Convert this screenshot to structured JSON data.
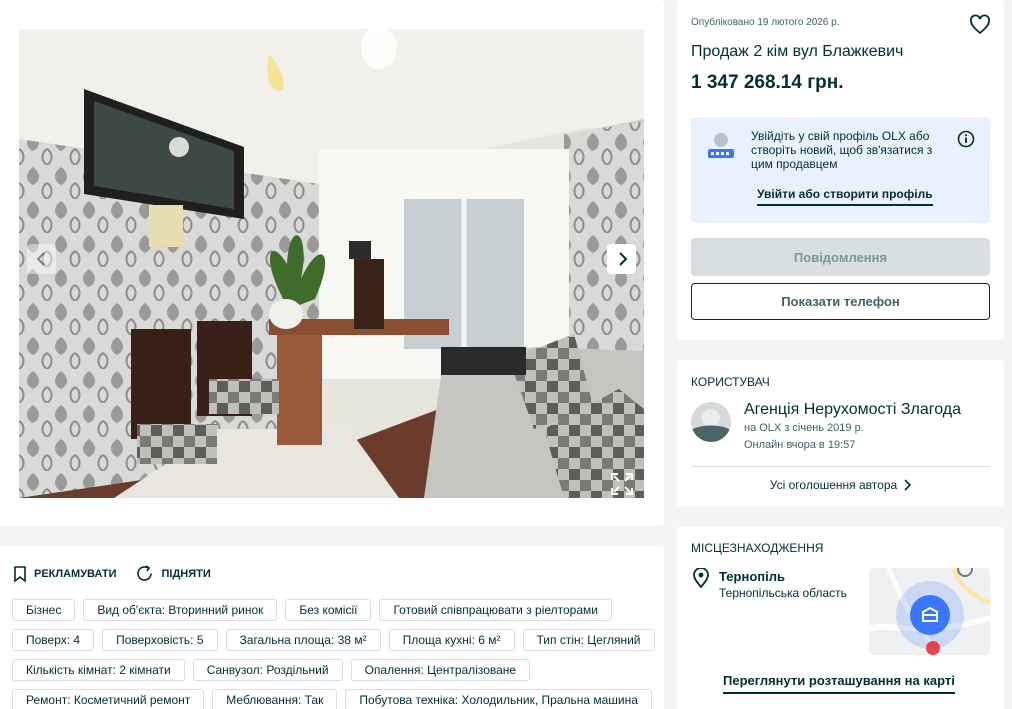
{
  "gallery": {
    "prev_icon": "chevron-left-icon",
    "next_icon": "chevron-right-icon",
    "expand_icon": "fullscreen-icon"
  },
  "details": {
    "promote_label": "РЕКЛАМУВАТИ",
    "raise_label": "ПІДНЯТИ",
    "tag_rows": [
      [
        "Бізнес",
        "Вид об'єкта: Вторинний ринок",
        "Без комісії",
        "Готовий співпрацювати з ріелторами"
      ],
      [
        "Поверх: 4",
        "Поверховість: 5",
        "Загальна площа: 38 м²",
        "Площа кухні: 6 м²",
        "Тип стін: Цегляний"
      ],
      [
        "Кількість кімнат: 2 кімнати",
        "Санвузол: Роздільний",
        "Опалення: Централізоване"
      ],
      [
        "Ремонт: Косметичний ремонт",
        "Меблювання: Так",
        "Побутова техніка: Холодильник, Пральна машина"
      ]
    ]
  },
  "ad": {
    "published": "Опубліковано 19 лютого 2026 р.",
    "title": "Продаж 2 кім вул Блажкевич",
    "price": "1 347 268.14 грн.",
    "login_prompt": "Увійдіть у свій профіль OLX або створіть новий, щоб зв'язатися з цим продавцем",
    "login_link": "Увійти або створити профіль",
    "message_button": "Повідомлення",
    "phone_button": "Показати телефон"
  },
  "user": {
    "section_label": "Користувач",
    "name": "Агенція Нерухомості Злагода",
    "since": "на OLX з січень 2019 р.",
    "online": "Онлайн вчора в 19:57",
    "all_ads": "Усі оголошення автора"
  },
  "location": {
    "section_label": "Місцезнаходження",
    "city": "Тернопіль",
    "region": "Тернопільська область",
    "map_link": "Переглянути розташування на карті"
  },
  "colors": {
    "brand_dark": "#002f34",
    "login_box_bg": "#e9f0fe",
    "map_marker": "#3a77ff",
    "disabled_button": "#d8dfe0"
  }
}
